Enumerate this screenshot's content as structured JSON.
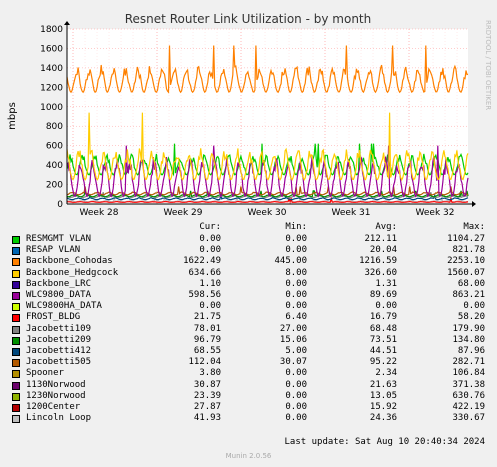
{
  "title": "Resnet Router Link Utilization - by month",
  "side_label": "RRDTOOL / TOBI OETIKER",
  "footer_credit": "Munin 2.0.56",
  "last_update": "Last update: Sat Aug 10 20:40:34 2024",
  "legend_headers": {
    "cur": "Cur:",
    "min": "Min:",
    "avg": "Avg:",
    "max": "Max:"
  },
  "legend": [
    {
      "name": "RESMGMT VLAN",
      "color": "#00cc00",
      "cur": "0.00",
      "min": "0.00",
      "avg": "212.11",
      "max": "1104.27"
    },
    {
      "name": "RESAP VLAN",
      "color": "#0066b3",
      "cur": "0.00",
      "min": "0.00",
      "avg": "20.04",
      "max": "821.78"
    },
    {
      "name": "Backbone_Cohodas",
      "color": "#ff8000",
      "cur": "1622.49",
      "min": "445.00",
      "avg": "1216.59",
      "max": "2253.10"
    },
    {
      "name": "Backbone_Hedgcock",
      "color": "#ffcc00",
      "cur": "634.66",
      "min": "8.00",
      "avg": "326.60",
      "max": "1560.07"
    },
    {
      "name": "Backbone_LRC",
      "color": "#330099",
      "cur": "1.10",
      "min": "0.00",
      "avg": "1.31",
      "max": "68.00"
    },
    {
      "name": "WLC9800_DATA",
      "color": "#990099",
      "cur": "598.56",
      "min": "0.00",
      "avg": "89.69",
      "max": "863.21"
    },
    {
      "name": "WLC9800HA_DATA",
      "color": "#ccff00",
      "cur": "0.00",
      "min": "0.00",
      "avg": "0.00",
      "max": "0.00"
    },
    {
      "name": "FROST_BLDG",
      "color": "#ff0000",
      "cur": "21.75",
      "min": "6.40",
      "avg": "16.79",
      "max": "58.20"
    },
    {
      "name": "Jacobetti109",
      "color": "#808080",
      "cur": "78.01",
      "min": "27.00",
      "avg": "68.48",
      "max": "179.90"
    },
    {
      "name": "Jacobetti209",
      "color": "#008f00",
      "cur": "96.79",
      "min": "15.06",
      "avg": "73.51",
      "max": "134.80"
    },
    {
      "name": "Jacobetti412",
      "color": "#00487d",
      "cur": "68.55",
      "min": "5.00",
      "avg": "44.51",
      "max": "87.96"
    },
    {
      "name": "Jacobetti505",
      "color": "#b35a00",
      "cur": "112.04",
      "min": "30.07",
      "avg": "95.22",
      "max": "282.71"
    },
    {
      "name": "Spooner",
      "color": "#b38f00",
      "cur": "3.80",
      "min": "0.00",
      "avg": "2.34",
      "max": "106.84"
    },
    {
      "name": "1130Norwood",
      "color": "#6b006b",
      "cur": "30.87",
      "min": "0.00",
      "avg": "21.63",
      "max": "371.38"
    },
    {
      "name": "1230Norwood",
      "color": "#8fb300",
      "cur": "23.39",
      "min": "0.00",
      "avg": "13.05",
      "max": "630.76"
    },
    {
      "name": "1200Center",
      "color": "#b30000",
      "cur": "27.87",
      "min": "0.00",
      "avg": "15.92",
      "max": "422.19"
    },
    {
      "name": "Lincoln Loop",
      "color": "#bebebe",
      "cur": "41.93",
      "min": "0.00",
      "avg": "24.36",
      "max": "330.67"
    }
  ],
  "chart_data": {
    "type": "line",
    "title": "Resnet Router Link Utilization - by month",
    "ylabel": "mbps",
    "xlabel": "",
    "ylim": [
      0,
      1800
    ],
    "yticks": [
      0,
      200,
      400,
      600,
      800,
      1000,
      1200,
      1400,
      1600,
      1800
    ],
    "xticks": [
      "Week 28",
      "Week 29",
      "Week 30",
      "Week 31",
      "Week 32"
    ],
    "grid": true,
    "series": [
      {
        "name": "Backbone_Cohodas",
        "color": "#ff8000",
        "baseline": 1150,
        "amplitude": 280,
        "spike": 1630
      },
      {
        "name": "Backbone_Hedgcock",
        "color": "#ffcc00",
        "baseline": 250,
        "amplitude": 330,
        "spike": 940
      },
      {
        "name": "WLC9800_DATA",
        "color": "#990099",
        "baseline": 80,
        "amplitude": 420,
        "spike": 600
      },
      {
        "name": "RESMGMT VLAN",
        "color": "#00cc00",
        "baseline": 300,
        "amplitude": 220,
        "spike": 620
      },
      {
        "name": "Jacobetti505",
        "color": "#b35a00",
        "baseline": 95,
        "amplitude": 30,
        "spike": 180
      },
      {
        "name": "Jacobetti209",
        "color": "#008f00",
        "baseline": 75,
        "amplitude": 25,
        "spike": 135
      },
      {
        "name": "Jacobetti109",
        "color": "#808080",
        "baseline": 68,
        "amplitude": 20,
        "spike": 120
      },
      {
        "name": "Jacobetti412",
        "color": "#00487d",
        "baseline": 45,
        "amplitude": 20,
        "spike": 88
      },
      {
        "name": "FROST_BLDG",
        "color": "#ff0000",
        "baseline": 17,
        "amplitude": 8,
        "spike": 58
      },
      {
        "name": "Lincoln Loop",
        "color": "#bebebe",
        "baseline": 24,
        "amplitude": 12,
        "spike": 60
      }
    ]
  }
}
